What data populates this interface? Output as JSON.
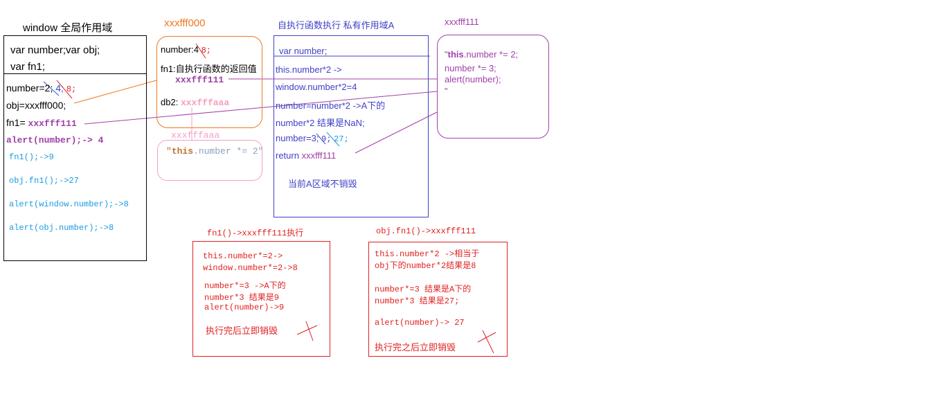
{
  "window_scope": {
    "title": "window  全局作用域",
    "decl1": "var number;var obj;",
    "decl2": "var fn1;",
    "number_line": "number=",
    "number_v1": "2;",
    "number_v2": "4;",
    "number_v3": "8;",
    "obj_line": "obj=xxxfff000;",
    "fn1_label": "fn1=",
    "fn1_value": "xxxfff111",
    "alert_line": "alert(number);-> 4",
    "calls": [
      "fn1();->9",
      "obj.fn1();->27",
      "alert(window.number);->8",
      "alert(obj.number);->8"
    ]
  },
  "obj_heap": {
    "title": "xxxfff000",
    "number_label": "number:",
    "number_old": "4",
    "number_new": "8;",
    "fn1_label": "fn1:自执行函数的返回值",
    "fn1_value": "xxxfff111",
    "db2_label": "db2:",
    "db2_value": "xxxfffaaa"
  },
  "aaa_heap": {
    "title": "xxxfffaaa",
    "code_q": "\"",
    "code_this": "this",
    "code_rest": ".number *= 2\""
  },
  "private_scope": {
    "title": "自执行函数执行 私有作用域A",
    "decl": "var number;",
    "lines": [
      "this.number*2 ->",
      "window.number*2=4",
      "number=number*2 ->A下的",
      "number*2  结果是NaN;"
    ],
    "number_line": "number=",
    "n1": "3;",
    "n2": "9;",
    "n3": "27;",
    "return_label": "return",
    "return_value": "xxxfff111",
    "note": "当前A区域不销毁"
  },
  "fn_heap": {
    "title": "xxxfff111",
    "line1_q": "\"",
    "line1_this": "this",
    "line1_rest": ".number *= 2;",
    "line2": "number *= 3;",
    "line3": "alert(number);",
    "line4": "\""
  },
  "exec1": {
    "title": "fn1()->xxxfff111执行",
    "lines": [
      "this.number*=2->",
      "window.number*=2->8",
      "number*=3 ->A下的",
      "number*3  结果是9",
      "alert(number)->9"
    ],
    "note": "执行完后立即销毁"
  },
  "exec2": {
    "title": "obj.fn1()->xxxfff111",
    "lines": [
      "this.number*2 ->相当于",
      "obj下的number*2结果是8",
      "number*=3 结果是A下的",
      "number*3 结果是27;",
      "alert(number)-> 27"
    ],
    "note": "执行完之后立即销毁"
  }
}
